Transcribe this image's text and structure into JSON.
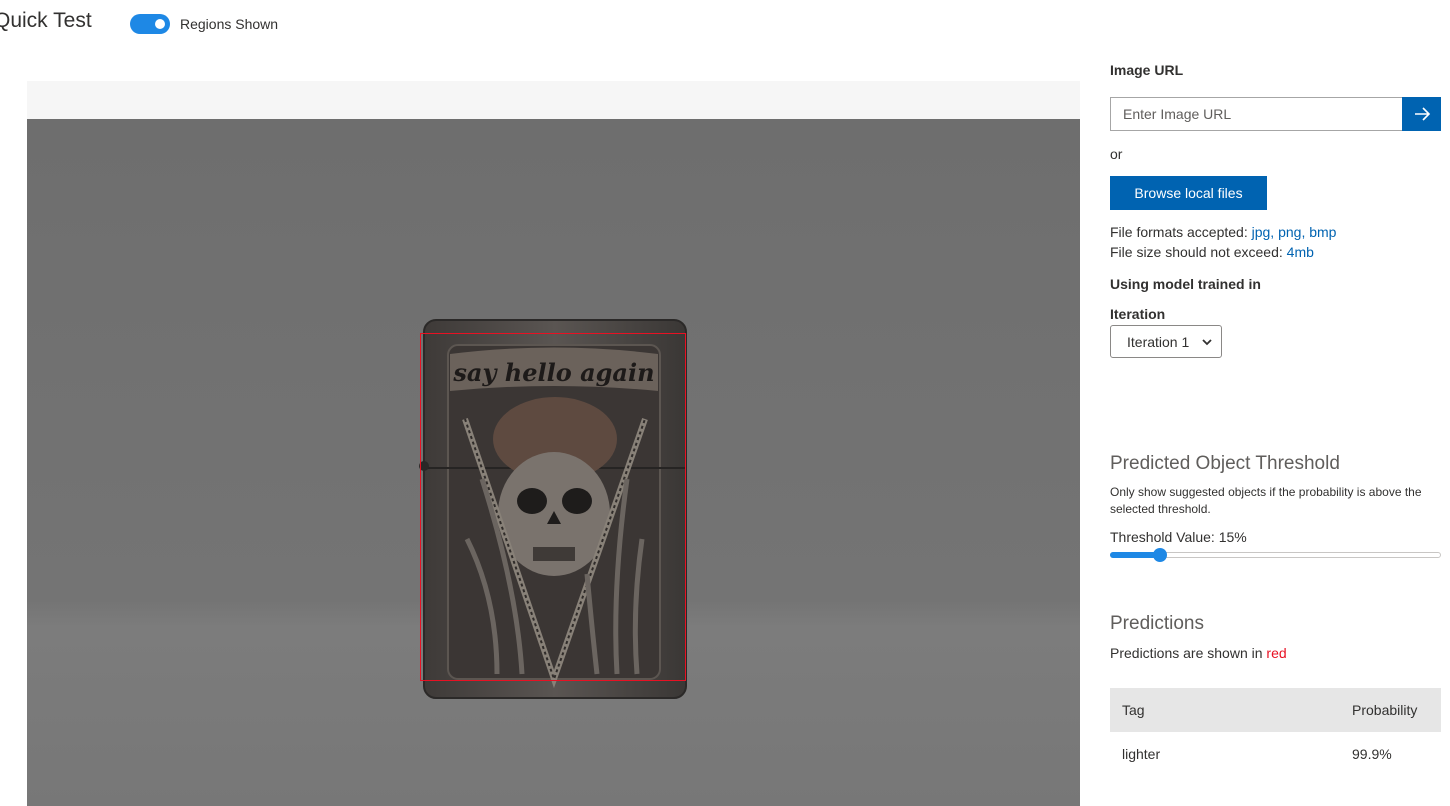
{
  "header": {
    "title": "Quick Test",
    "regions_toggle_label": "Regions Shown",
    "regions_toggle_on": true
  },
  "image_area": {
    "photo_engraving_text": "say hello again",
    "region_color": "#e81123"
  },
  "side_panel": {
    "image_url_label": "Image URL",
    "image_url_placeholder": "Enter Image URL",
    "image_url_value": "",
    "submit_icon": "arrow-right-icon",
    "or_text": "or",
    "browse_button": "Browse local files",
    "file_formats_prefix": "File formats accepted:",
    "file_formats": "jpg, png, bmp",
    "file_size_prefix": "File size should not exceed:",
    "file_size": "4mb",
    "model_label": "Using model trained in",
    "iteration_label": "Iteration",
    "iteration_selected": "Iteration 1",
    "threshold_title": "Predicted Object Threshold",
    "threshold_description": "Only show suggested objects if the probability is above the selected threshold.",
    "threshold_label": "Threshold Value: 15%",
    "threshold_value": 0.15,
    "predictions_title": "Predictions",
    "predictions_prefix": "Predictions are shown in",
    "predictions_color_word": "red",
    "table_headers": {
      "tag": "Tag",
      "probability": "Probability"
    },
    "rows": [
      {
        "tag": "lighter",
        "probability": "99.9%"
      }
    ]
  },
  "colors": {
    "accent": "#0063b1",
    "toggle": "#1e88e5",
    "prediction": "#e81123"
  }
}
